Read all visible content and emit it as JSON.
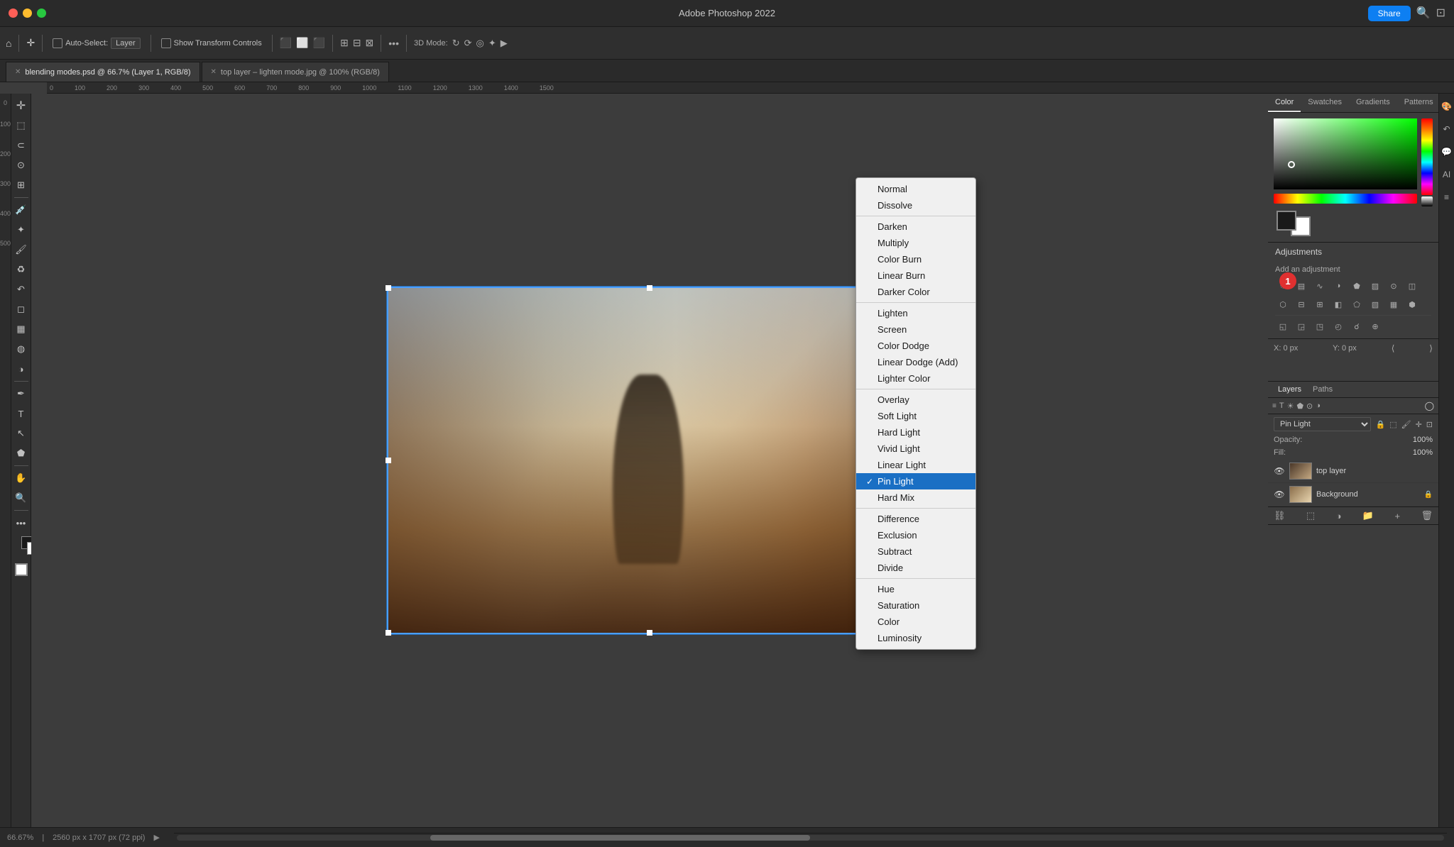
{
  "app": {
    "title": "Adobe Photoshop 2022",
    "share_label": "Share"
  },
  "tabs": [
    {
      "label": "blending modes.psd @ 66.7% (Layer 1, RGB/8)",
      "active": true,
      "closeable": true
    },
    {
      "label": "top layer – lighten mode.jpg @ 100% (RGB/8)",
      "active": false,
      "closeable": true
    }
  ],
  "toolbar": {
    "auto_select_label": "Auto-Select:",
    "layer_label": "Layer",
    "transform_label": "Show Transform Controls",
    "mode_label": "3D Mode:"
  },
  "color_tabs": [
    "Color",
    "Swatches",
    "Gradients",
    "Patterns"
  ],
  "adjustments": {
    "header": "Adjustments",
    "add_label": "Add an adjustment"
  },
  "layers": {
    "tabs": [
      "Layers",
      "Paths"
    ],
    "blend_mode": "Pin Light",
    "opacity_label": "Opacity:",
    "opacity_val": "100%",
    "fill_label": "Fill:",
    "fill_val": "100%",
    "items": [
      {
        "name": "top layer",
        "visible": true,
        "locked": false
      },
      {
        "name": "Background",
        "visible": true,
        "locked": true
      }
    ]
  },
  "blend_modes": {
    "groups": [
      {
        "items": [
          "Normal",
          "Dissolve"
        ]
      },
      {
        "items": [
          "Darken",
          "Multiply",
          "Color Burn",
          "Linear Burn",
          "Darker Color"
        ]
      },
      {
        "items": [
          "Lighten",
          "Screen",
          "Color Dodge",
          "Linear Dodge (Add)",
          "Lighter Color"
        ]
      },
      {
        "items": [
          "Overlay",
          "Soft Light",
          "Hard Light",
          "Vivid Light",
          "Linear Light",
          "Pin Light",
          "Hard Mix"
        ]
      },
      {
        "items": [
          "Difference",
          "Exclusion",
          "Subtract",
          "Divide"
        ]
      },
      {
        "items": [
          "Hue",
          "Saturation",
          "Color",
          "Luminosity"
        ]
      }
    ],
    "selected": "Pin Light"
  },
  "status": {
    "zoom": "66.67%",
    "dimensions": "2560 px x 1707 px (72 ppi)"
  }
}
